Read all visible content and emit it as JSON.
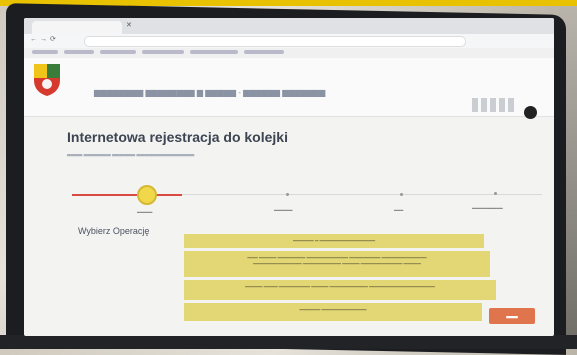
{
  "page": {
    "title": "Internetowa rejestracja do kolejki",
    "section_label": "Wybierz Operację"
  },
  "colors": {
    "accent_red": "#d94a40",
    "step_active": "#f1d74a",
    "option_bg": "#e3d675",
    "next_button": "#e0744d"
  },
  "icons": [
    "crest-icon",
    "close-icon",
    "back-icon",
    "forward-icon",
    "reload-icon",
    "user-avatar-icon"
  ]
}
